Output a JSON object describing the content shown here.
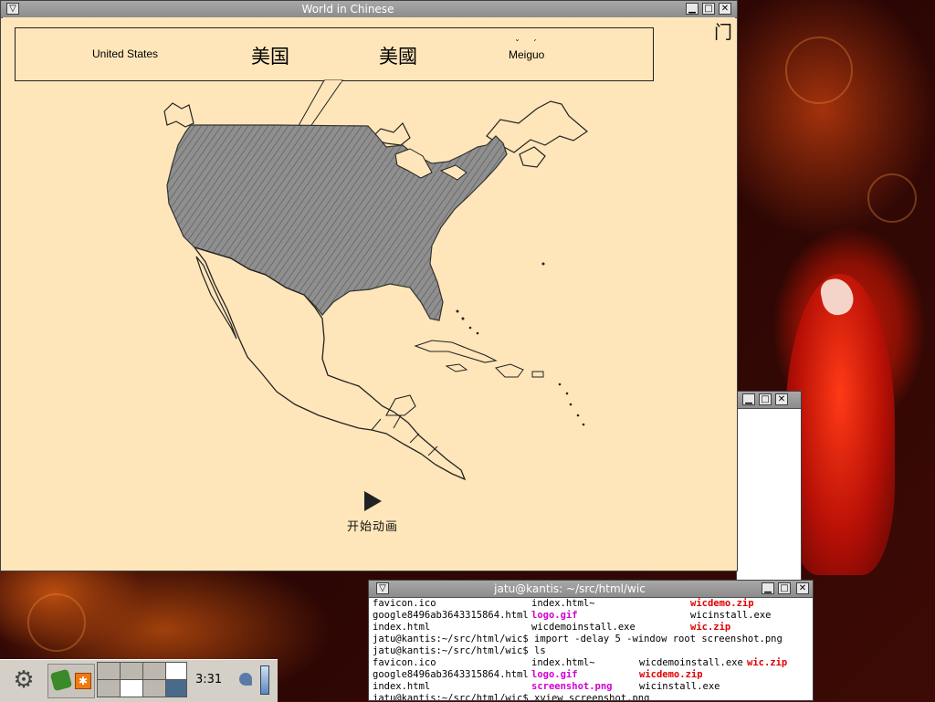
{
  "main_window": {
    "title": "World in Chinese",
    "corner_glyph": "门",
    "banner": {
      "english": "United States",
      "simplified": "美国",
      "traditional": "美國",
      "pinyin": "Meiguo"
    },
    "map": {
      "highlighted_country": "United States"
    },
    "play_button": {
      "label": "开始动画"
    }
  },
  "terminal": {
    "title": "jatu@kantis: ~/src/html/wic",
    "lines": [
      [
        "favicon.ico",
        "index.html~",
        "wicdemo.zip"
      ],
      [
        "google8496ab3643315864.html",
        "logo.gif",
        "wicinstall.exe"
      ],
      [
        "index.html",
        "wicdemoinstall.exe",
        "wic.zip"
      ],
      [
        "jatu@kantis:~/src/html/wic$ import -delay 5 -window root screenshot.png"
      ],
      [
        "jatu@kantis:~/src/html/wic$ ls"
      ],
      [
        "favicon.ico",
        "index.html~",
        "wicdemoinstall.exe",
        "wic.zip"
      ],
      [
        "google8496ab3643315864.html",
        "logo.gif",
        "wicdemo.zip"
      ],
      [
        "index.html",
        "screenshot.png",
        "wicinstall.exe"
      ],
      [
        "jatu@kantis:~/src/html/wic$ xview screenshot.png"
      ]
    ]
  },
  "taskbar": {
    "clock": "3:31"
  },
  "colors": {
    "window_bg": "#ffe6ba",
    "highlight_fill": "#8f8f8f",
    "terminal_archive": "#e00000",
    "terminal_image": "#d000d0"
  }
}
